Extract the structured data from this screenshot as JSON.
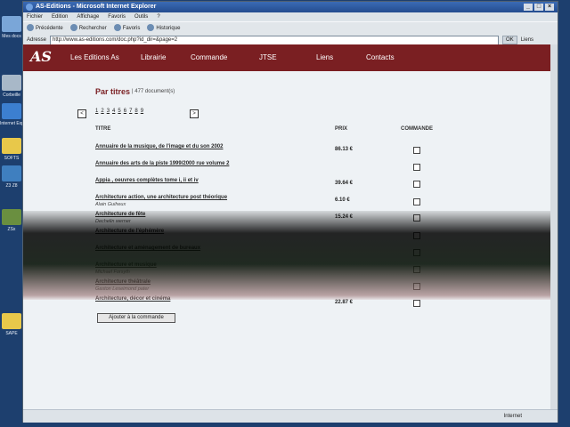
{
  "window": {
    "title": "AS-Editions - Microsoft Internet Explorer",
    "menu": [
      "Fichier",
      "Edition",
      "Affichage",
      "Favoris",
      "Outils",
      "?"
    ],
    "toolbar": [
      "Précédente",
      "Rechercher",
      "Favoris",
      "Historique"
    ],
    "address_label": "Adresse",
    "address_value": "http://www.as-editions.com/doc.php?id_dir=&page=2",
    "go_label": "OK",
    "links_label": "Liens",
    "status_zone": "Internet"
  },
  "site": {
    "logo": "AS",
    "nav": [
      "Les Editions As",
      "Librairie",
      "Commande",
      "JTSE",
      "Liens",
      "Contacts"
    ]
  },
  "listing": {
    "title": "Par titres",
    "count": "| 477 document(s)",
    "prev": "<",
    "next": ">",
    "pages": [
      "1",
      "2",
      "3",
      "4",
      "5",
      "6",
      "7",
      "8",
      "9"
    ],
    "headers": {
      "title": "TITRE",
      "price": "PRIX",
      "order": "COMMANDE"
    },
    "rows": [
      {
        "title": "Annuaire de la musique, de l'image et du son 2002",
        "author": "",
        "price": "86.13 €"
      },
      {
        "title": "Annuaire des arts de la piste 1999/2000 rue volume 2",
        "author": "",
        "price": ""
      },
      {
        "title": "Appia , oeuvres complètes tome i, ii et iv",
        "author": "",
        "price": "39.64 €"
      },
      {
        "title": "Architecture action, une architecture post théorique",
        "author": "Alain Guiheux",
        "price": "6.10 €"
      },
      {
        "title": "Architecture de fête",
        "author": "Dechelin werner",
        "price": "15.24 €"
      },
      {
        "title": "Architecture de l'éphémère",
        "author": "",
        "price": ""
      },
      {
        "title": "Architecture et aménagement de bureaux",
        "author": "",
        "price": ""
      },
      {
        "title": "Architecture et musique",
        "author": "Michael Forsyth",
        "price": ""
      },
      {
        "title": "Architecture théâtrale",
        "author": "Gaston Leseimond pater",
        "price": ""
      },
      {
        "title": "Architecture, décor et cinéma",
        "author": "",
        "price": "22.87 €"
      }
    ],
    "add_button": "Ajouter à la commande"
  },
  "desktop_icons": [
    "Mes docs",
    "Corbeille",
    "Internet Explorer",
    "SOFTS",
    "Z3 Z8",
    "ZSx",
    "SAPE"
  ]
}
